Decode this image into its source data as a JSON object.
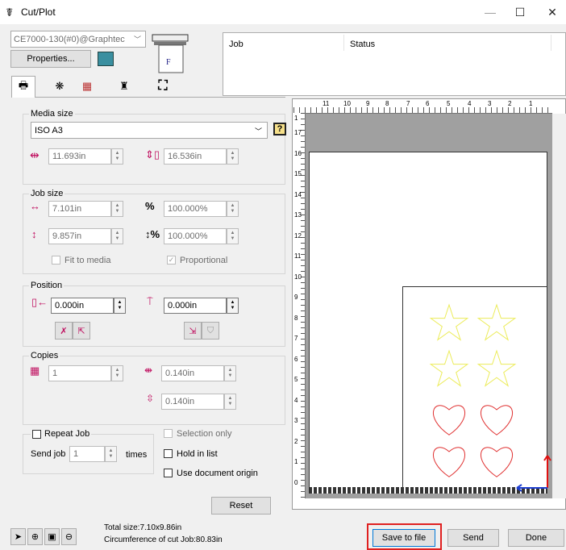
{
  "window": {
    "title": "Cut/Plot",
    "minimize": "—",
    "maximize": "☐",
    "close": "✕"
  },
  "device": {
    "selected": "CE7000-130(#0)@Graphtec",
    "properties_label": "Properties..."
  },
  "queue": {
    "col_job": "Job",
    "col_status": "Status"
  },
  "media_size": {
    "label": "Media size",
    "preset": "ISO A3",
    "width": "11.693in",
    "height": "16.536in"
  },
  "job_size": {
    "label": "Job size",
    "width": "7.101in",
    "width_pct": "100.000%",
    "height": "9.857in",
    "height_pct": "100.000%",
    "fit_to_media": "Fit to media",
    "proportional": "Proportional"
  },
  "position": {
    "label": "Position",
    "x": "0.000in",
    "y": "0.000in"
  },
  "copies": {
    "label": "Copies",
    "count": "1",
    "gap_h": "0.140in",
    "gap_v": "0.140in"
  },
  "repeat": {
    "repeat_job": "Repeat Job",
    "send_job": "Send job",
    "times_value": "1",
    "times": "times",
    "selection_only": "Selection only",
    "hold_in_list": "Hold in list",
    "use_document_origin": "Use document origin"
  },
  "reset_label": "Reset",
  "ruler": {
    "top": [
      "11",
      "10",
      "9",
      "8",
      "7",
      "6",
      "5",
      "4",
      "3",
      "2",
      "1"
    ],
    "left": [
      "1",
      "17",
      "16",
      "15",
      "14",
      "13",
      "12",
      "11",
      "10",
      "9",
      "8",
      "7",
      "6",
      "5",
      "4",
      "3",
      "2",
      "1",
      "0"
    ]
  },
  "status": {
    "total_size": "Total size:7.10x9.86in",
    "circumference": "Circumference of cut Job:80.83in"
  },
  "actions": {
    "save_to_file": "Save to file",
    "send": "Send",
    "done": "Done"
  },
  "colors": {
    "star": "#ecec5a",
    "heart": "#e03030",
    "highlight": "#e02020",
    "axis_x": "#1f3fd0",
    "axis_y": "#e01010"
  }
}
